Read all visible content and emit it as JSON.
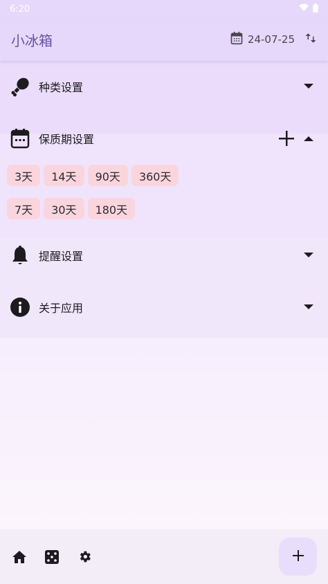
{
  "status_bar": {
    "time": "6:20",
    "icons": [
      "wifi-icon",
      "battery-icon"
    ]
  },
  "app_bar": {
    "title": "小冰箱",
    "date": "24-07-25",
    "icons": [
      "calendar-icon",
      "swap-vert-icon"
    ]
  },
  "sections": {
    "category": {
      "label": "种类设置",
      "icon": "drumstick-icon",
      "expanded": false
    },
    "shelf_life": {
      "label": "保质期设置",
      "icon": "calendar-icon",
      "expanded": true,
      "chips_row1": [
        "3天",
        "14天",
        "90天",
        "360天"
      ],
      "chips_row2": [
        "7天",
        "30天",
        "180天"
      ]
    },
    "reminder": {
      "label": "提醒设置",
      "icon": "bell-icon",
      "expanded": false
    },
    "about": {
      "label": "关于应用",
      "icon": "info-icon",
      "expanded": false
    }
  },
  "bottom_nav": {
    "items": [
      "home-icon",
      "dice-icon",
      "settings-icon"
    ],
    "fab": "add-icon"
  },
  "colors": {
    "primary": "#6750a4",
    "app_bar": "#e6d8fb",
    "chip": "#fbd5de",
    "fab": "#e8ddfb"
  }
}
